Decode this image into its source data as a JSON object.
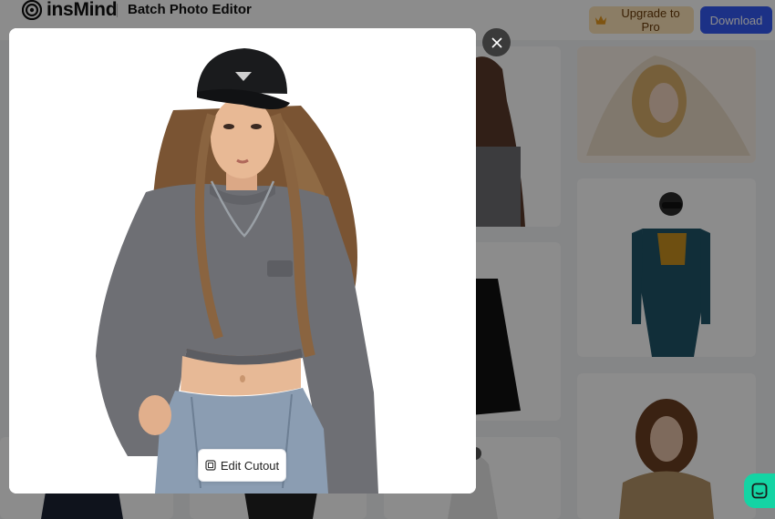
{
  "header": {
    "logo_text": "insMind",
    "title": "Batch Photo Editor",
    "upgrade_label": "Upgrade to Pro",
    "download_label": "Download"
  },
  "modal": {
    "edit_cutout_label": "Edit Cutout"
  },
  "icons": {
    "logo": "insmind-logo-icon",
    "crown": "crown-icon",
    "close": "close-icon",
    "cutout": "cutout-icon",
    "chat": "chat-icon"
  },
  "colors": {
    "primary": "#3459f5",
    "upgrade_bg": "#fde3b8",
    "chat": "#14d4a4",
    "overlay": "rgba(0,0,0,0.45)"
  }
}
